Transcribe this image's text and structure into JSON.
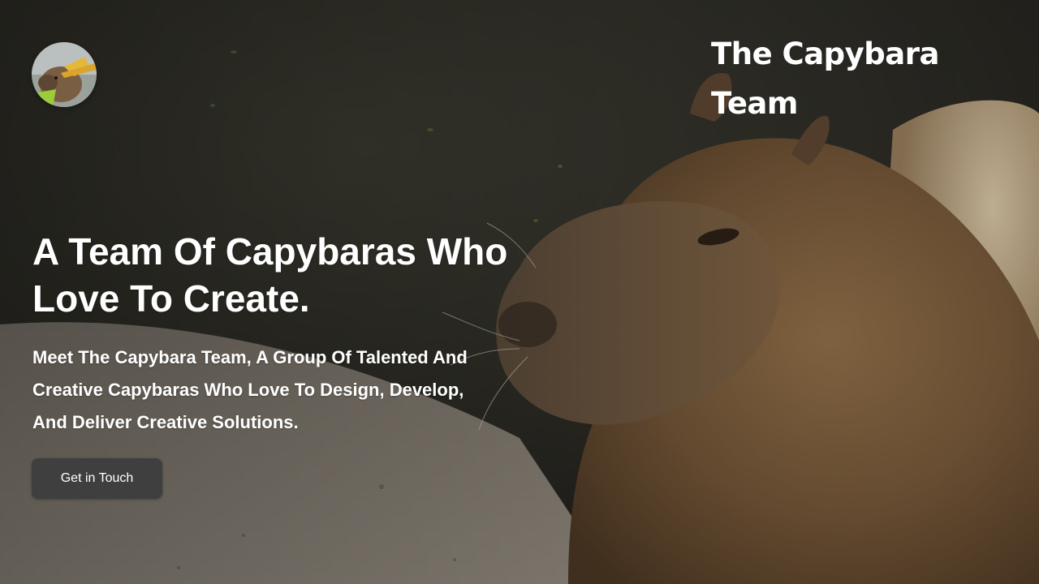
{
  "brand": {
    "title": "The Capybara Team",
    "logo_icon": "capybara-avatar-icon"
  },
  "hero": {
    "heading": "A Team Of Capybaras Who Love To Create.",
    "subtext": "Meet The Capybara Team, A Group Of Talented And Creative Capybaras Who Love To Design, Develop, And Deliver Creative Solutions.",
    "cta_label": "Get in Touch",
    "background_image": "capybara-photo"
  },
  "colors": {
    "text": "#ffffff",
    "button_bg": "#3f3f40"
  }
}
